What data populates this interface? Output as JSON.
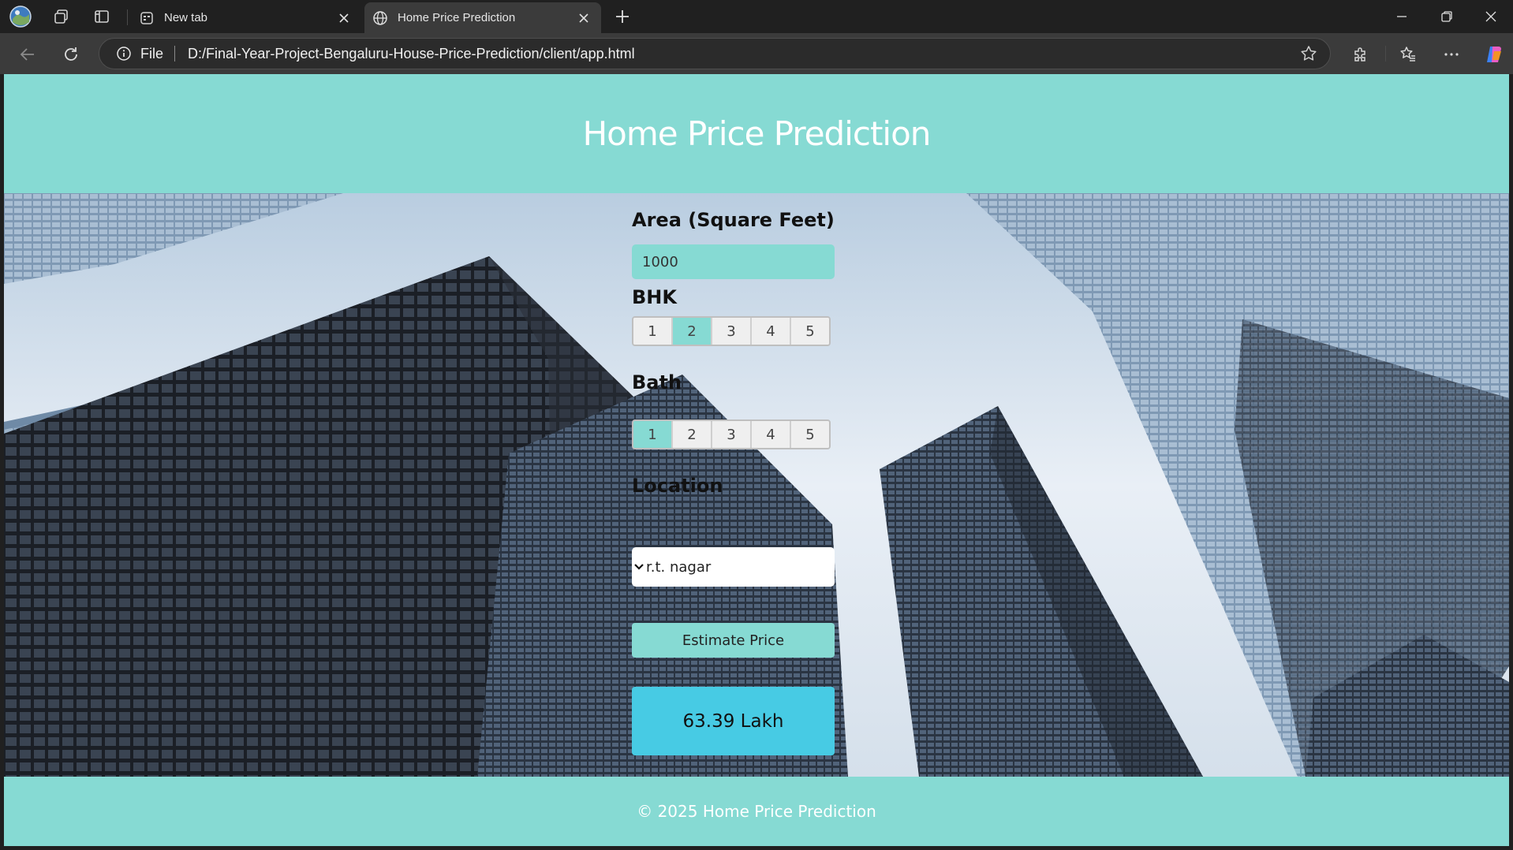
{
  "browser": {
    "tabs": [
      {
        "title": "New tab",
        "icon": "new-tab-icon"
      },
      {
        "title": "Home Price Prediction",
        "icon": "globe-icon"
      }
    ],
    "address": {
      "scheme_label": "File",
      "url": "D:/Final-Year-Project-Bengaluru-House-Price-Prediction/client/app.html"
    }
  },
  "page": {
    "title": "Home Price Prediction",
    "area": {
      "label": "Area (Square Feet)",
      "value": "1000"
    },
    "bhk": {
      "label": "BHK",
      "options": [
        "1",
        "2",
        "3",
        "4",
        "5"
      ],
      "selected": "2"
    },
    "bath": {
      "label": "Bath",
      "options": [
        "1",
        "2",
        "3",
        "4",
        "5"
      ],
      "selected": "1"
    },
    "location": {
      "label": "Location",
      "value": "r.t. nagar"
    },
    "estimate_button": "Estimate Price",
    "result": "63.39 Lakh",
    "footer": "© 2025 Home Price Prediction"
  },
  "colors": {
    "accent": "#86dad3",
    "result": "#47cbe4"
  }
}
